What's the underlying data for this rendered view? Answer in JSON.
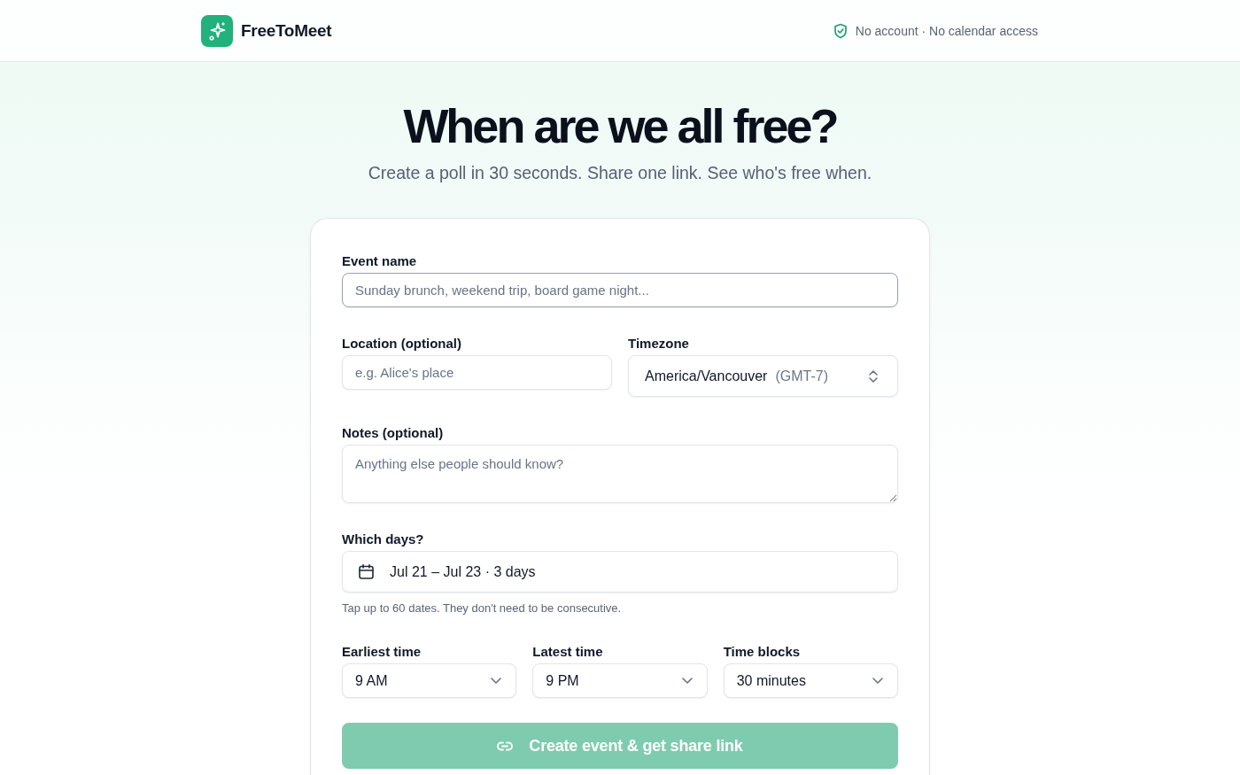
{
  "header": {
    "brand": "FreeToMeet",
    "privacy_note": "No account · No calendar access"
  },
  "hero": {
    "title": "When are we all free?",
    "subtitle": "Create a poll in 30 seconds. Share one link. See who's free when."
  },
  "form": {
    "event_name": {
      "label": "Event name",
      "placeholder": "Sunday brunch, weekend trip, board game night...",
      "focused": true
    },
    "location": {
      "label": "Location (optional)",
      "placeholder": "e.g. Alice's place",
      "focused": false
    },
    "timezone": {
      "label": "Timezone",
      "value": "America/Vancouver",
      "detail": "(GMT-7)",
      "focused": false
    },
    "notes": {
      "label": "Notes (optional)",
      "placeholder": "Anything else people should know?",
      "focused": false
    },
    "days": {
      "label": "Which days?",
      "value": "Jul 21 – Jul 23 · 3 days",
      "hint": "Tap up to 60 dates. They don't need to be consecutive.",
      "focused": false
    },
    "earliest_time": {
      "label": "Earliest time",
      "value": "9 AM",
      "focused": false
    },
    "latest_time": {
      "label": "Latest time",
      "value": "9 PM",
      "focused": false
    },
    "time_blocks": {
      "label": "Time blocks",
      "value": "30 minutes",
      "focused": false
    },
    "submit": {
      "label": "Create event & get share link",
      "disabled": true
    }
  }
}
